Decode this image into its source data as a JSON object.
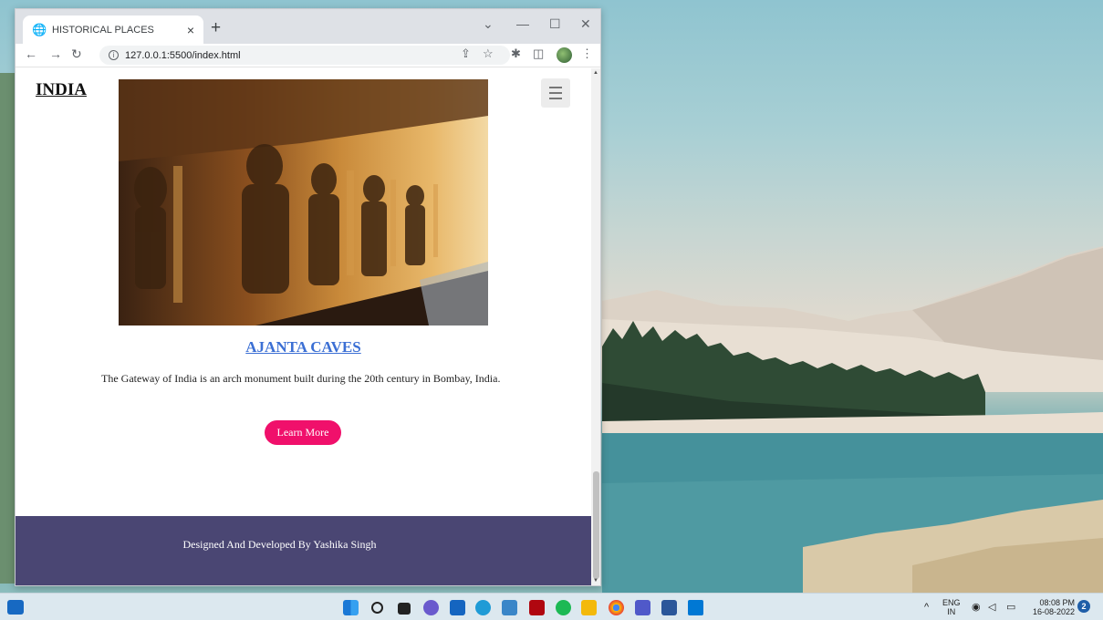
{
  "browser": {
    "tab_title": "HISTORICAL PLACES",
    "url": "127.0.0.1:5500/index.html"
  },
  "page": {
    "brand": "INDIA",
    "place_title": "AJANTA CAVES",
    "place_description": "The Gateway of India is an arch monument built during the 20th century in Bombay, India.",
    "learn_more_label": "Learn More",
    "footer_text": "Designed And Developed By Yashika Singh"
  },
  "taskbar": {
    "language": "ENG",
    "region": "IN",
    "time": "08:08 PM",
    "date": "16-08-2022",
    "notification_count": "2"
  },
  "colors": {
    "accent_pink": "#f0106b",
    "footer_bg": "#4a4673",
    "link_blue": "#3b6fd4"
  }
}
